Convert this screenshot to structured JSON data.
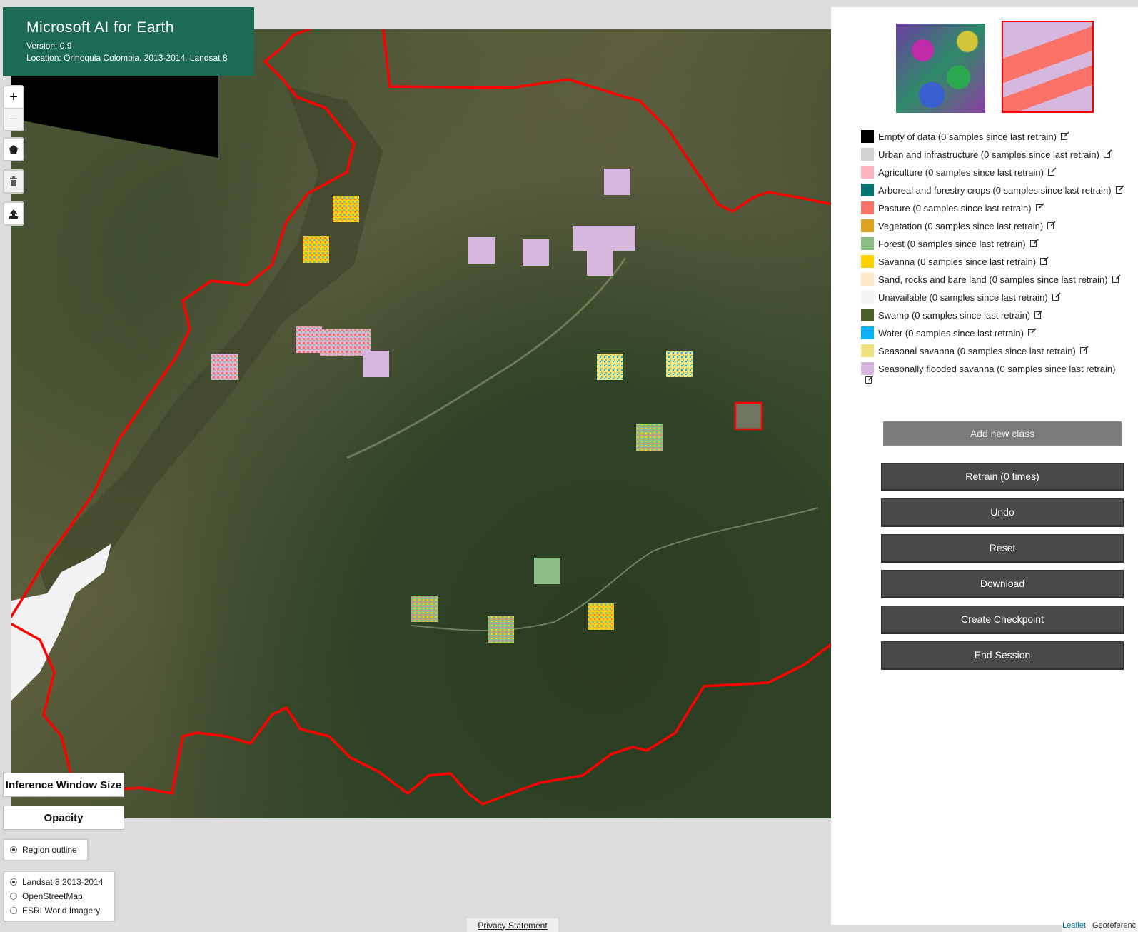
{
  "brand": {
    "title": "Microsoft AI for Earth",
    "version": "Version: 0.9",
    "location": "Location: Orinoquia Colombia, 2013-2014, Landsat 8"
  },
  "map_controls": {
    "zoom_in": "+",
    "zoom_out": "−",
    "draw_polygon_icon": "pentagon-icon",
    "delete_icon": "trash-icon",
    "upload_icon": "upload-icon"
  },
  "bottom_controls": {
    "inference_window_size": "Inference Window Size",
    "opacity": "Opacity",
    "region_outline": "Region outline",
    "basemaps": [
      {
        "label": "Landsat 8 2013-2014",
        "selected": true
      },
      {
        "label": "OpenStreetMap",
        "selected": false
      },
      {
        "label": "ESRI World Imagery",
        "selected": false
      }
    ]
  },
  "legend": [
    {
      "label": "Empty of data (0 samples since last retrain)",
      "color": "#000000"
    },
    {
      "label": "Urban and infrastructure (0 samples since last retrain)",
      "color": "#d3d3d3"
    },
    {
      "label": "Agriculture (0 samples since last retrain)",
      "color": "#ffb6c1"
    },
    {
      "label": "Arboreal and forestry crops (0 samples since last retrain)",
      "color": "#00736f"
    },
    {
      "label": "Pasture (0 samples since last retrain)",
      "color": "#fa7268"
    },
    {
      "label": "Vegetation (0 samples since last retrain)",
      "color": "#dea121"
    },
    {
      "label": "Forest (0 samples since last retrain)",
      "color": "#8bbd85"
    },
    {
      "label": "Savanna (0 samples since last retrain)",
      "color": "#ffd200"
    },
    {
      "label": "Sand, rocks and bare land (0 samples since last retrain)",
      "color": "#fde9c8"
    },
    {
      "label": "Unavailable (0 samples since last retrain)",
      "color": "#f5f5f5"
    },
    {
      "label": "Swamp (0 samples since last retrain)",
      "color": "#4b5e2b"
    },
    {
      "label": "Water (0 samples since last retrain)",
      "color": "#0aaff5"
    },
    {
      "label": "Seasonal savanna (0 samples since last retrain)",
      "color": "#ede27e"
    },
    {
      "label": "Seasonally flooded savanna (0 samples since last retrain)",
      "color": "#d6b7dd"
    }
  ],
  "panel": {
    "add_class": "Add new class",
    "retrain": "Retrain (0 times)",
    "undo": "Undo",
    "reset": "Reset",
    "download": "Download",
    "create_checkpoint": "Create Checkpoint",
    "end_session": "End Session",
    "edit_icon": "edit-icon"
  },
  "footer": {
    "privacy": "Privacy Statement",
    "attribution_link": "Leaflet",
    "attribution_text": " | Georeferenc"
  },
  "colors": {
    "brand_bg": "#1d6a55",
    "region_outline": "#ff0000",
    "button_bg": "#4a4a4a"
  }
}
